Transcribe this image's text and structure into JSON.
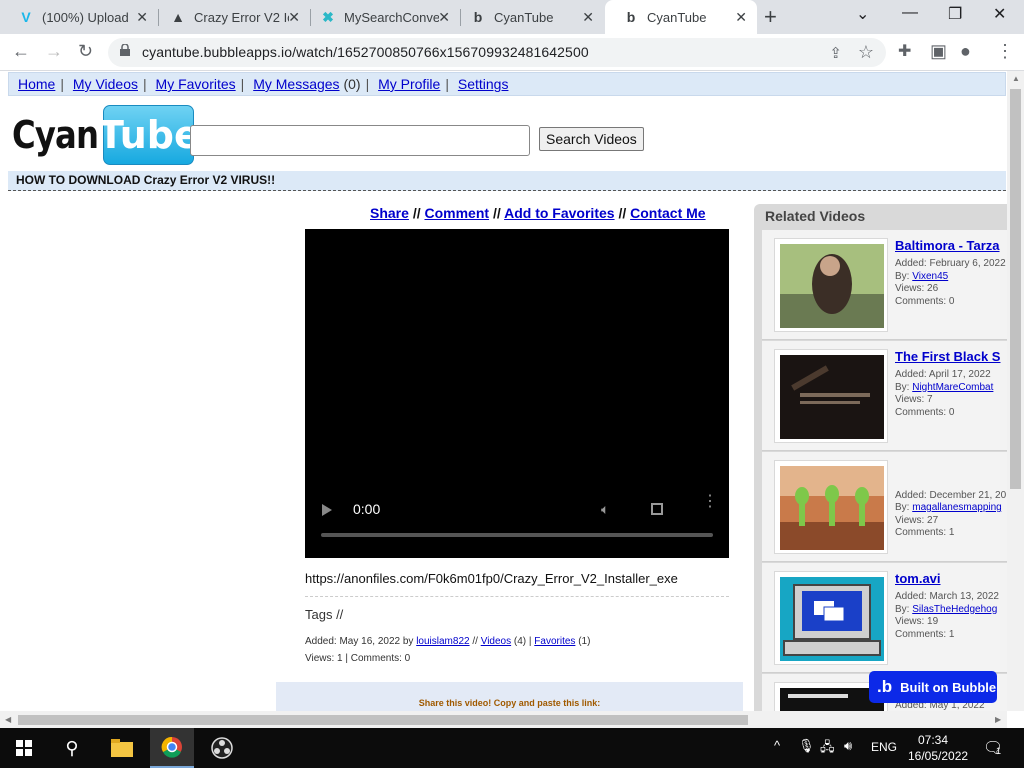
{
  "browser": {
    "tabs": [
      {
        "title": "(100%) Upload",
        "icon": "vimeo-icon"
      },
      {
        "title": "Crazy Error V2 Ic",
        "icon": "tent-icon"
      },
      {
        "title": "MySearchConve",
        "icon": "converter-icon"
      },
      {
        "title": "CyanTube",
        "icon": "bubble-icon"
      },
      {
        "title": "CyanTube",
        "icon": "bubble-icon",
        "active": true
      }
    ],
    "url": "cyantube.bubbleapps.io/watch/1652700850766x156709932481642500"
  },
  "nav": {
    "home": "Home",
    "my_videos": "My Videos",
    "my_favorites": "My Favorites",
    "my_messages": "My Messages",
    "messages_count": "(0)",
    "my_profile": "My Profile",
    "settings": "Settings"
  },
  "logo": {
    "part1": "Cyan",
    "part2": "Tube"
  },
  "search": {
    "button": "Search Videos",
    "value": ""
  },
  "video": {
    "title": "HOW TO DOWNLOAD Crazy Error V2 VIRUS!!",
    "actions": {
      "share": "Share",
      "comment": "Comment",
      "favorite": "Add to Favorites",
      "contact": "Contact Me",
      "separator": "//"
    },
    "time": "0:00",
    "description": "https://anonfiles.com/F0k6m01fp0/Crazy_Error_V2_Installer_exe",
    "tags_label": "Tags //",
    "added": "Added: May 16, 2022 by",
    "uploader": "louislam822",
    "videos_link": "Videos",
    "videos_count": "(4) |",
    "favorites_link": "Favorites",
    "favorites_count": "(1)",
    "views_comments": "Views: 1 | Comments: 0",
    "share_prompt": "Share this video! Copy and paste this link:"
  },
  "related": {
    "heading": "Related Videos",
    "items": [
      {
        "title": "Baltimora - Tarza",
        "added": "Added: February 6, 2022",
        "by_label": "By:",
        "by": "Vixen45",
        "views": "Views: 26",
        "comments": "Comments: 0"
      },
      {
        "title": "The First Black S",
        "added": "Added: April 17, 2022",
        "by_label": "By:",
        "by": "NightMareCombat",
        "views": "Views: 7",
        "comments": "Comments: 0"
      },
      {
        "title": "",
        "added": "Added: December 21, 20",
        "by_label": "By:",
        "by": "magallanesmapping",
        "views": "Views: 27",
        "comments": "Comments: 1"
      },
      {
        "title": "tom.avi",
        "added": "Added: March 13, 2022",
        "by_label": "By:",
        "by": "SilasTheHedgehog",
        "views": "Views: 19",
        "comments": "Comments: 1"
      },
      {
        "title": "",
        "added": "Added: May 1, 2022",
        "by_label": "",
        "by": "",
        "views": "",
        "comments": ""
      }
    ]
  },
  "bubble_badge": "Built on Bubble",
  "taskbar": {
    "lang": "ENG",
    "time": "07:34",
    "date": "16/05/2022",
    "notifications": "1"
  }
}
